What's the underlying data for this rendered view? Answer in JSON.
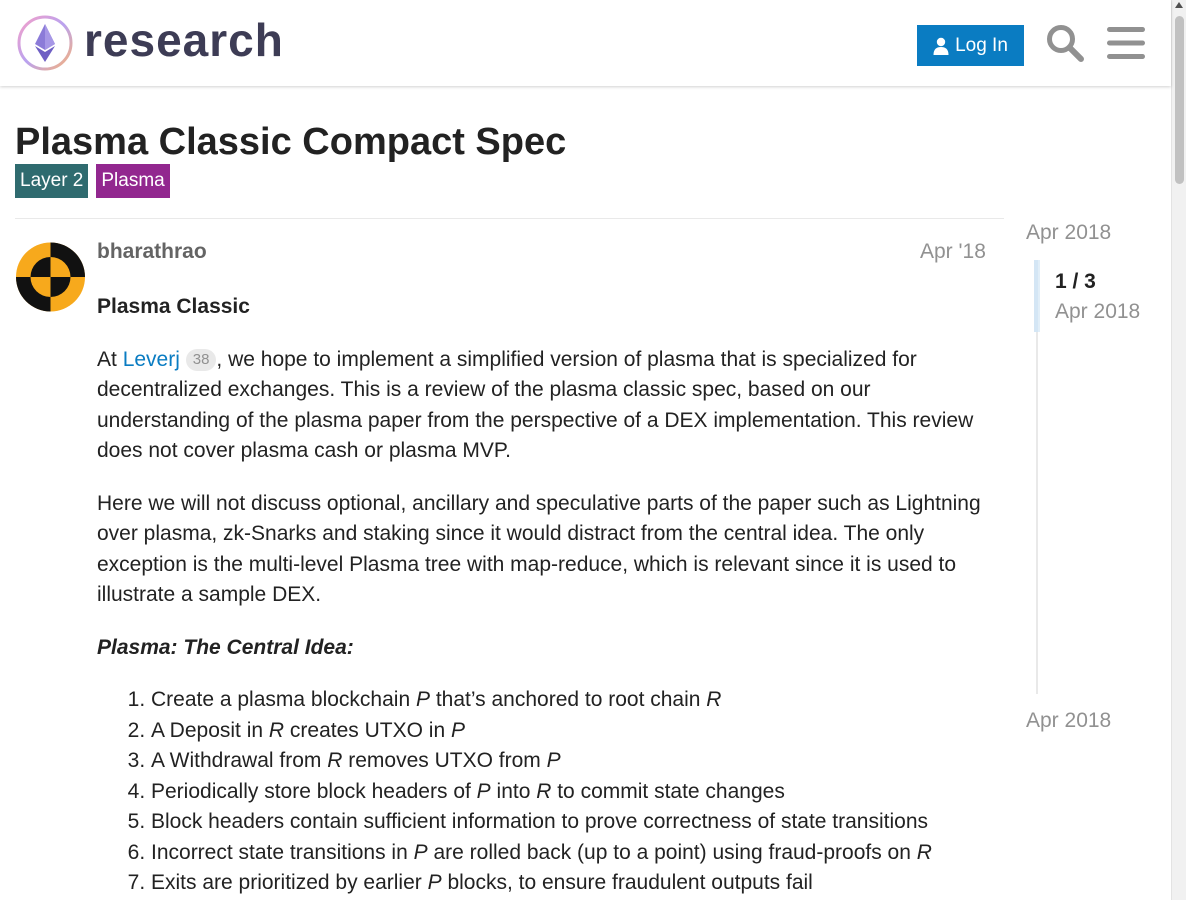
{
  "header": {
    "site_name": "research",
    "login_label": "Log In"
  },
  "colors": {
    "brand_blue": "#0a7cc2",
    "tag_layer2": "#2f6b6f",
    "tag_plasma": "#92278f"
  },
  "icons": {
    "logo": "ethereum-research-logo",
    "login": "user-icon",
    "search": "search-icon",
    "menu": "hamburger-icon"
  },
  "topic": {
    "title": "Plasma Classic Compact Spec",
    "tags": [
      {
        "label": "Layer 2",
        "color": "#2f6b6f"
      },
      {
        "label": "Plasma",
        "color": "#92278f"
      }
    ]
  },
  "post": {
    "username": "bharathrao",
    "date": "Apr '18",
    "heading": "Plasma Classic",
    "para1_prefix": "At ",
    "para1_link": "Leverj",
    "para1_badge": "38",
    "para1_rest": ", we hope to implement a simplified version of plasma that is specialized for decentralized exchanges. This is a review of the plasma classic spec, based on our understanding of the plasma paper from the perspective of a DEX implementation. This review does not cover plasma cash or plasma MVP.",
    "para2": "Here we will not discuss optional, ancillary and speculative parts of the paper such as Lightning over plasma, zk-Snarks and staking since it would distract from the central idea. The only exception is the multi-level Plasma tree with map-reduce, which is relevant since it is used to illustrate a sample DEX.",
    "central_idea_heading": "Plasma: The Central Idea:",
    "list": [
      [
        "Create a plasma blockchain ",
        "P",
        " that’s anchored to root chain ",
        "R",
        ""
      ],
      [
        "A Deposit in ",
        "R",
        " creates UTXO in ",
        "P",
        ""
      ],
      [
        "A Withdrawal from ",
        "R",
        " removes UTXO from ",
        "P",
        ""
      ],
      [
        "Periodically store block headers of ",
        "P",
        " into ",
        "R",
        " to commit state changes"
      ],
      [
        "Block headers contain sufficient information to prove correctness of state transitions",
        "",
        "",
        "",
        ""
      ],
      [
        "Incorrect state transitions in ",
        "P",
        " are rolled back (up to a point) using fraud-proofs on ",
        "R",
        ""
      ],
      [
        "Exits are prioritized by earlier ",
        "P",
        " blocks, to ensure fraudulent outputs fail",
        "",
        ""
      ]
    ]
  },
  "timeline": {
    "start_date": "Apr 2018",
    "position": "1 / 3",
    "current_date": "Apr 2018",
    "end_date": "Apr 2018"
  }
}
